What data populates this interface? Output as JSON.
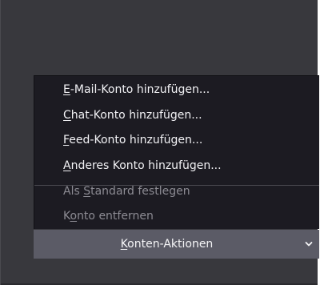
{
  "menu": {
    "items": [
      {
        "accel": "E",
        "rest": "-Mail-Konto hinzufügen...",
        "enabled": true
      },
      {
        "accel": "C",
        "rest": "hat-Konto hinzufügen...",
        "enabled": true
      },
      {
        "accel": "F",
        "rest": "eed-Konto hinzufügen...",
        "enabled": true
      },
      {
        "accel": "A",
        "rest": "nderes Konto hinzufügen...",
        "enabled": true
      }
    ],
    "set_default": {
      "pre": "Als ",
      "accel": "S",
      "post": "tandard festlegen",
      "enabled": false
    },
    "remove": {
      "pre": "K",
      "accel": "o",
      "post": "nto entfernen",
      "enabled": false
    }
  },
  "action_button": {
    "accel": "K",
    "rest": "onten-Aktionen",
    "icon": "chevron-down-icon"
  },
  "colors": {
    "window_bg": "#38383d",
    "menu_bg": "#1c1b22",
    "button_bg": "#5b5b66",
    "text": "#f2f2f5",
    "disabled_text": "#8c8b93"
  }
}
